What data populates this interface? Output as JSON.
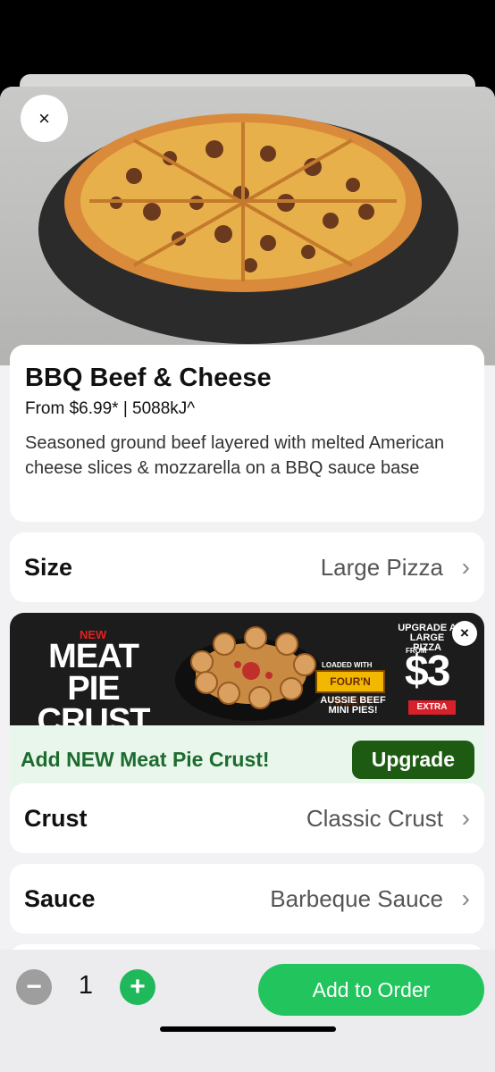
{
  "product": {
    "title": "BBQ Beef & Cheese",
    "meta": "From $6.99* | 5088kJ^",
    "description": "Seasoned ground beef layered with melted American cheese slices & mozzarella on a BBQ sauce base"
  },
  "close_icon": "×",
  "options": {
    "size": {
      "label": "Size",
      "value": "Large Pizza"
    },
    "crust": {
      "label": "Crust",
      "value": "Classic Crust"
    },
    "sauce": {
      "label": "Sauce",
      "value": "Barbeque Sauce"
    }
  },
  "chevron": "›",
  "promo": {
    "new_tag": "NEW",
    "title": "MEAT PIE CRUST",
    "loaded_with": "LOADED WITH",
    "brand": "FOUR'N TWENTY",
    "aussie": "AUSSIE BEEF MINI PIES!",
    "upgrade": "UPGRADE A LARGE PIZZA",
    "from": "FROM",
    "price": "$3",
    "extra": "EXTRA",
    "close_icon": "×"
  },
  "upgrade": {
    "text": "Add NEW Meat Pie Crust!",
    "button": "Upgrade"
  },
  "quantity": {
    "minus": "−",
    "value": "1",
    "plus": "+"
  },
  "add_to_order": "Add to Order",
  "colors": {
    "accent_green": "#22c45e",
    "upgrade_dark_green": "#1e5b12",
    "upgrade_text_green": "#1d6b2e"
  }
}
